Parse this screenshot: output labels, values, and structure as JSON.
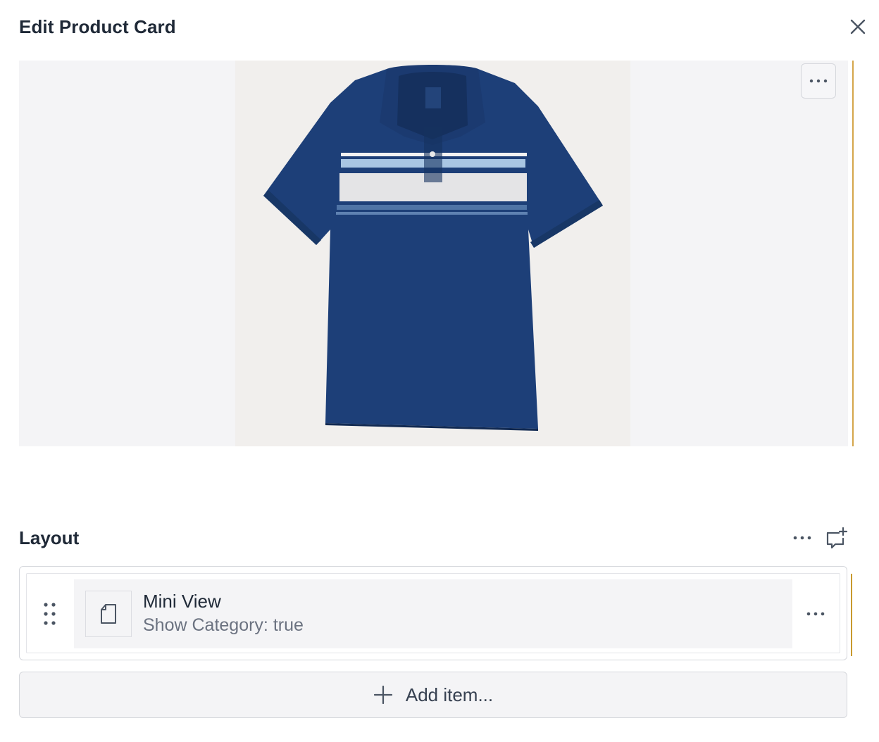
{
  "header": {
    "title": "Edit Product Card",
    "close_icon": "close-icon"
  },
  "image": {
    "description_icon": "product-image",
    "menu_icon": "more-horizontal-icon",
    "accent_color": "#d4a54a"
  },
  "layout": {
    "title": "Layout",
    "menu_icon": "more-horizontal-icon",
    "add_comment_icon": "comment-plus-icon",
    "items": [
      {
        "title": "Mini View",
        "subtitle": "Show Category: true",
        "thumb_icon": "document-icon",
        "drag_icon": "drag-handle-icon",
        "menu_icon": "more-horizontal-icon"
      }
    ],
    "add_label": "Add item..."
  },
  "colors": {
    "accent": "#c99a2e",
    "shirt_navy": "#1d3f78",
    "text": "#1f2937",
    "muted": "#6b7280"
  }
}
